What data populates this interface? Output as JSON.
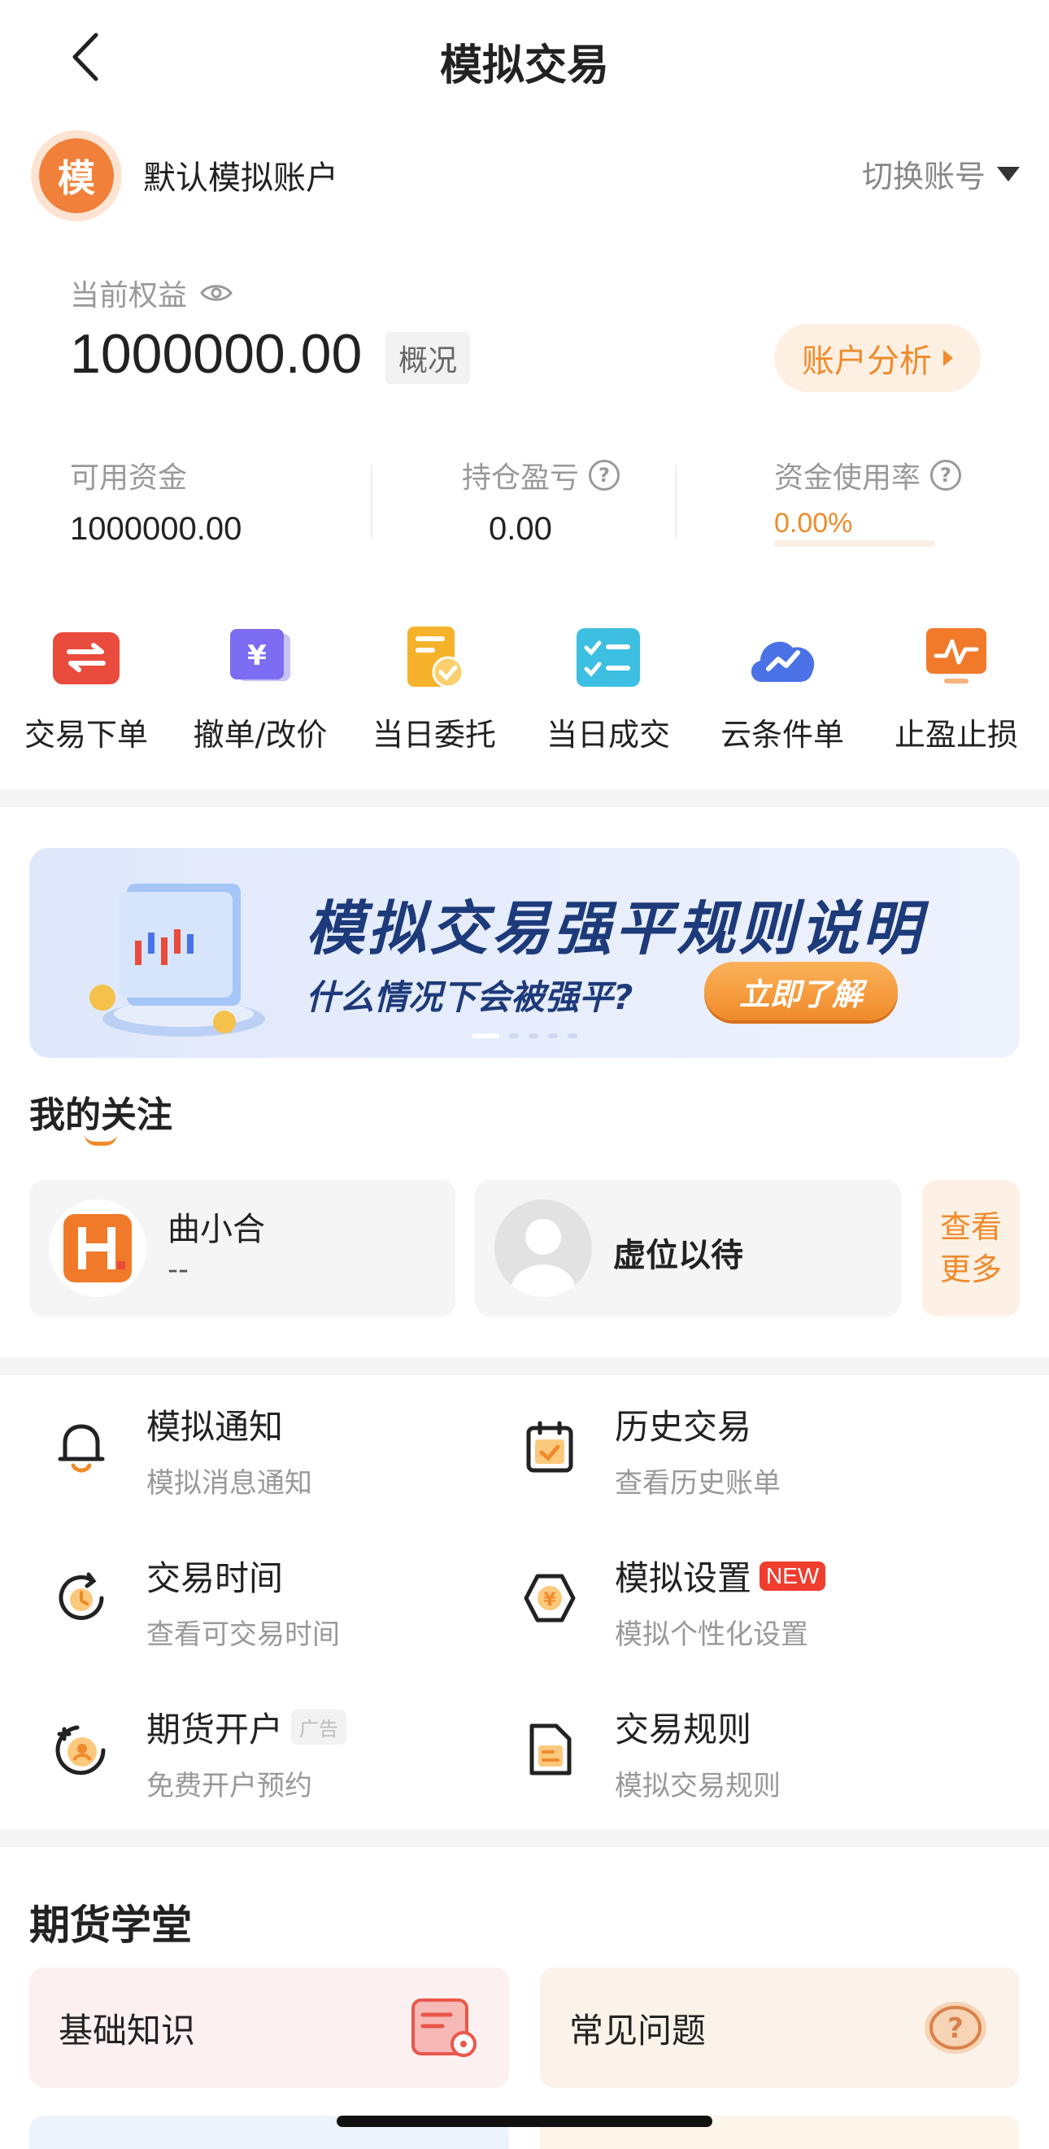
{
  "header": {
    "title": "模拟交易"
  },
  "account": {
    "avatar_char": "模",
    "name": "默认模拟账户",
    "switch_label": "切换账号"
  },
  "equity": {
    "label": "当前权益",
    "value": "1000000.00",
    "overview_label": "概况",
    "analysis_label": "账户分析"
  },
  "stats": {
    "available_label": "可用资金",
    "available_value": "1000000.00",
    "pnl_label": "持仓盈亏",
    "pnl_value": "0.00",
    "usage_label": "资金使用率",
    "usage_value": "0.00%",
    "usage_fraction": 0
  },
  "actions": [
    {
      "label": "交易下单",
      "icon": "swap-icon",
      "color": "#e94b3c"
    },
    {
      "label": "撤单/改价",
      "icon": "yen-card-icon",
      "color": "#7b6cf2"
    },
    {
      "label": "当日委托",
      "icon": "order-check-icon",
      "color": "#f5b22a"
    },
    {
      "label": "当日成交",
      "icon": "checklist-icon",
      "color": "#3cbfe0"
    },
    {
      "label": "云条件单",
      "icon": "cloud-icon",
      "color": "#4a72e6"
    },
    {
      "label": "止盈止损",
      "icon": "chart-monitor-icon",
      "color": "#f07a2a"
    }
  ],
  "banner": {
    "title": "模拟交易强平规则说明",
    "subtitle": "什么情况下会被强平?",
    "cta": "立即了解"
  },
  "follow": {
    "title": "我的关注",
    "cards": [
      {
        "name": "曲小合",
        "sub": "--"
      },
      {
        "name": "虚位以待",
        "sub": ""
      }
    ],
    "more_line1": "查看",
    "more_line2": "更多"
  },
  "menu": [
    {
      "title": "模拟通知",
      "sub": "模拟消息通知",
      "icon": "bell-icon"
    },
    {
      "title": "历史交易",
      "sub": "查看历史账单",
      "icon": "calendar-check-icon"
    },
    {
      "title": "交易时间",
      "sub": "查看可交易时间",
      "icon": "clock-icon"
    },
    {
      "title": "模拟设置",
      "sub": "模拟个性化设置",
      "icon": "yen-hexagon-icon",
      "badge": "NEW"
    },
    {
      "title": "期货开户",
      "sub": "免费开户预约",
      "icon": "add-user-icon",
      "badge": "广告"
    },
    {
      "title": "交易规则",
      "sub": "模拟交易规则",
      "icon": "document-icon"
    }
  ],
  "school": {
    "title": "期货学堂",
    "cards": [
      {
        "label": "基础知识",
        "icon": "document-search-icon",
        "bg": "#fdf0f0"
      },
      {
        "label": "常见问题",
        "icon": "question-icon",
        "bg": "#fbf3ea"
      }
    ]
  }
}
